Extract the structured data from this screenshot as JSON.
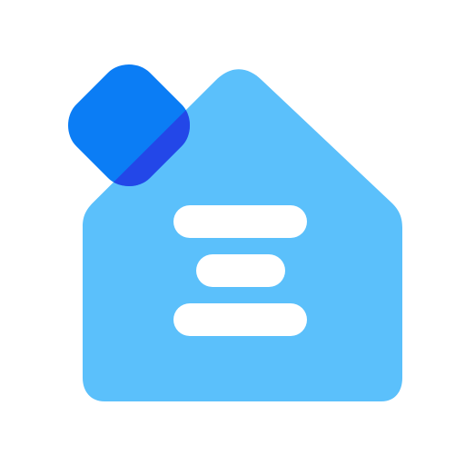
{
  "icon": {
    "name": "house-app-icon",
    "glyphs": [
      "house-icon",
      "rounded-square-icon",
      "menu-lines-icon"
    ],
    "colors": {
      "background": "#ffffff",
      "house": "#5BC0FB",
      "badge": "#0B7DF5",
      "badge_overlap": "#2347E8",
      "lines": "#ffffff"
    }
  }
}
